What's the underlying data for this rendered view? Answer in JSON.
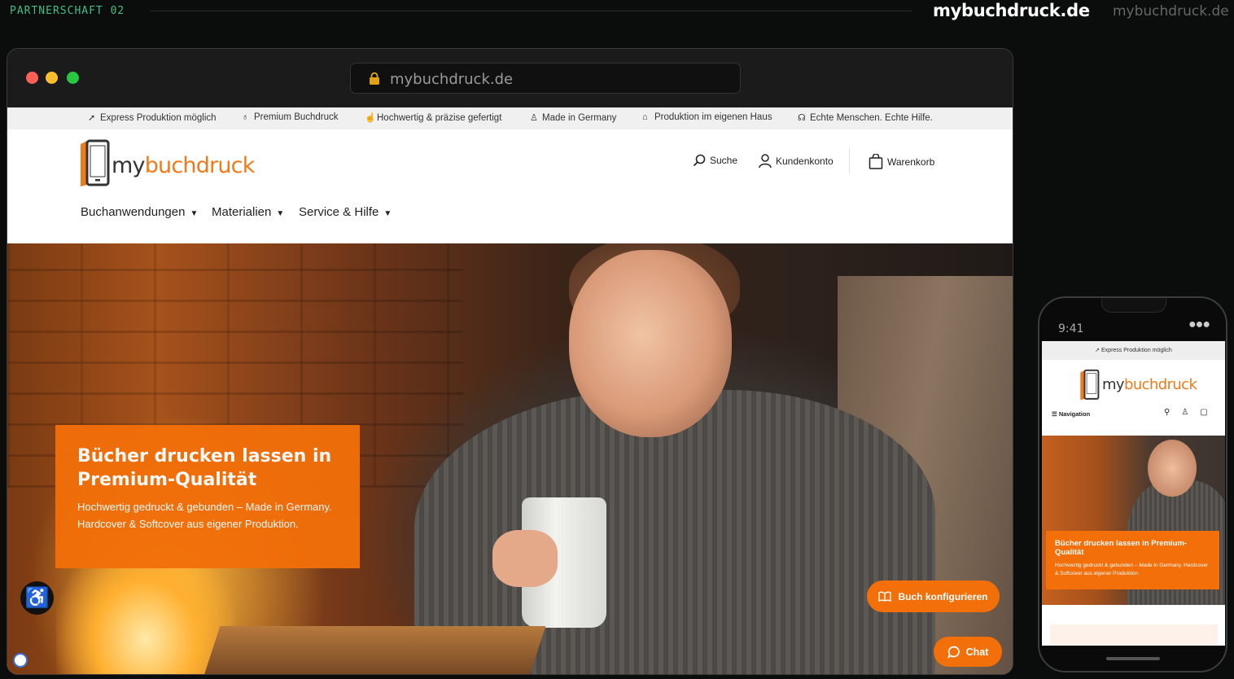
{
  "header": {
    "label": "PARTNERSCHAFT 02",
    "brand_primary": "mybuchdruck.de",
    "brand_secondary": "mybuchdruck.de"
  },
  "browser": {
    "url": "mybuchdruck.de"
  },
  "site": {
    "usps": [
      {
        "icon": "rocket-icon",
        "label": "Express Produktion möglich"
      },
      {
        "icon": "medal-icon",
        "label": "Premium Buchdruck"
      },
      {
        "icon": "thumbs-up-icon",
        "label": "Hochwertig & präzise gefertigt"
      },
      {
        "icon": "trophy-icon",
        "label": "Made in Germany"
      },
      {
        "icon": "factory-icon",
        "label": "Produktion im eigenen Haus"
      },
      {
        "icon": "headset-icon",
        "label": "Echte Menschen. Echte Hilfe."
      }
    ],
    "logo": {
      "my": "my",
      "rest": "buchdruck"
    },
    "header_nav": {
      "search": "Suche",
      "account": "Kundenkonto",
      "cart": "Warenkorb"
    },
    "menu": [
      "Buchanwendungen",
      "Materialien",
      "Service & Hilfe"
    ],
    "hero": {
      "title": "Bücher drucken lassen in Premium-Qualität",
      "subtitle": "Hochwertig gedruckt & gebunden – Made in Germany. Hardcover & Softcover aus eigener Produktion."
    },
    "configure_button": "Buch konfigurieren",
    "chat_button": "Chat"
  },
  "phone": {
    "time": "9:41",
    "usp": "Express Produktion möglich",
    "nav_label": "Navigation",
    "hero_title": "Bücher drucken lassen in Premium-Qualität",
    "hero_subtitle": "Hochwertig gedruckt & gebunden – Made in Germany. Hardcover & Softcover aus eigener Produktion."
  },
  "colors": {
    "accent": "#f26f0a",
    "brand_green": "#3fbf86",
    "background": "#0b0c0c"
  }
}
